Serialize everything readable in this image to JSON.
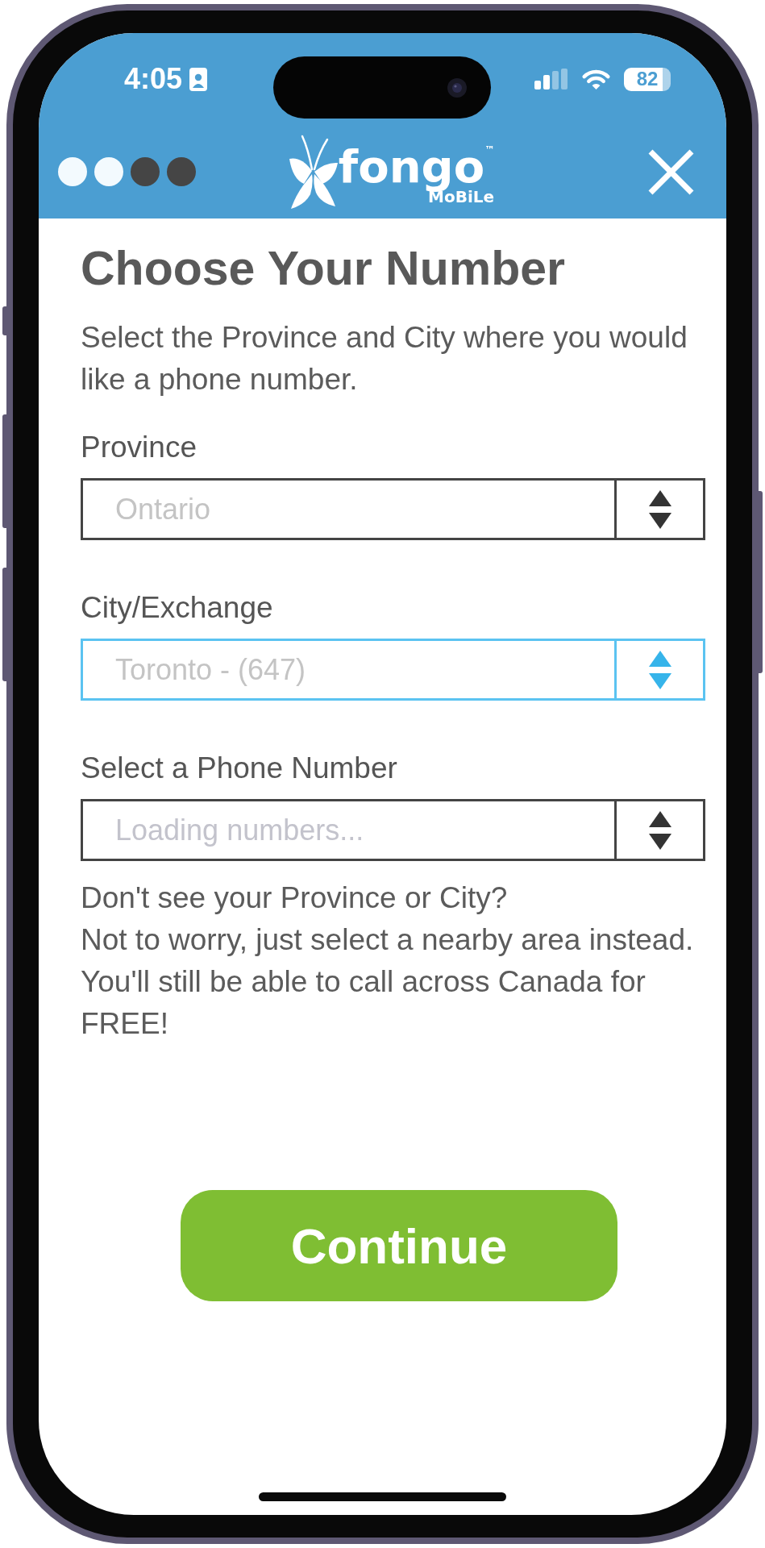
{
  "status_bar": {
    "time": "4:05",
    "battery": "82"
  },
  "header": {
    "steps": [
      {
        "completed": true
      },
      {
        "completed": true
      },
      {
        "completed": false
      },
      {
        "completed": false
      }
    ],
    "logo": {
      "wordmark": "fongo$^{™}$",
      "tagline": "MoBiLe"
    }
  },
  "page": {
    "title": "Choose Your Number",
    "intro": "Select the Province and City where you would like a phone number."
  },
  "fields": [
    {
      "label": "Province",
      "value": "Ontario",
      "focused": false
    },
    {
      "label": "City/Exchange",
      "value": "Toronto - (647)",
      "focused": true
    },
    {
      "label": "Select a Phone Number",
      "placeholder": "Loading numbers...",
      "focused": false
    }
  ],
  "help": [
    "Don't see your Province or City?",
    "Not to worry, just select a nearby area instead. You'll still be able to call across Canada for FREE!"
  ],
  "buttons": [
    {
      "label": "Continue"
    }
  ]
}
